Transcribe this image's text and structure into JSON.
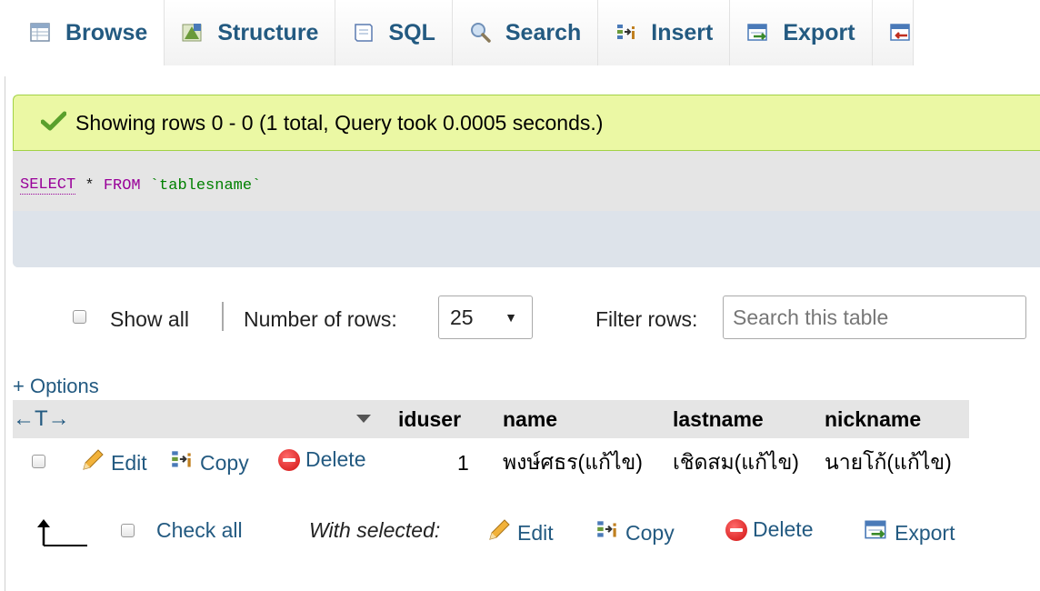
{
  "tabs": [
    {
      "label": "Browse",
      "icon": "browse-icon"
    },
    {
      "label": "Structure",
      "icon": "structure-icon"
    },
    {
      "label": "SQL",
      "icon": "sql-icon"
    },
    {
      "label": "Search",
      "icon": "search-icon"
    },
    {
      "label": "Insert",
      "icon": "insert-icon"
    },
    {
      "label": "Export",
      "icon": "export-icon"
    }
  ],
  "message": {
    "text": "Showing rows 0 - 0 (1 total, Query took 0.0005 seconds.)",
    "icon": "checkmark-icon"
  },
  "sql": {
    "kw_select": "SELECT",
    "star": " * ",
    "kw_from": "FROM",
    "table": " `tablesname`"
  },
  "nav": {
    "show_all": "Show all",
    "number_of_rows_label": "Number of rows:",
    "rows_value": "25",
    "filter_label": "Filter rows:",
    "filter_placeholder": "Search this table"
  },
  "table": {
    "options_link": "+ Options",
    "arrows": "←T→",
    "columns": [
      "iduser",
      "name",
      "lastname",
      "nickname"
    ],
    "rows": [
      {
        "edit": "Edit",
        "copy": "Copy",
        "delete": "Delete",
        "iduser": "1",
        "name": "พงษ์ศธร(แก้ไข)",
        "lastname": "เชิดสม(แก้ไข)",
        "nickname": "นายโก้(แก้ไข)"
      }
    ]
  },
  "bulk": {
    "check_all": "Check all",
    "with_selected": "With selected:",
    "edit": "Edit",
    "copy": "Copy",
    "delete": "Delete",
    "export": "Export"
  },
  "colors": {
    "link": "#235a81",
    "success_bg": "#ebf8a4",
    "success_border": "#a2d246",
    "sql_bg": "#e5e5e5"
  }
}
